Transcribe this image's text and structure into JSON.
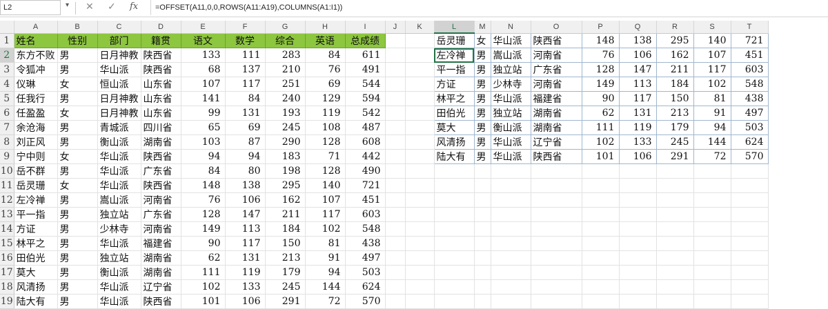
{
  "formula_bar": {
    "name_box": "L2",
    "cancel_icon": "✕",
    "confirm_icon": "✓",
    "fx_label": "fx",
    "formula": "=OFFSET(A11,0,0,ROWS(A11:A19),COLUMNS(A1:I1))"
  },
  "columns": [
    "A",
    "B",
    "C",
    "D",
    "E",
    "F",
    "G",
    "H",
    "I",
    "J",
    "K",
    "L",
    "M",
    "N",
    "O",
    "P",
    "Q",
    "R",
    "S",
    "T"
  ],
  "selected": {
    "column": "L",
    "row": 2
  },
  "header_row": [
    "姓名",
    "性别",
    "部门",
    "籍贯",
    "语文",
    "数学",
    "综合",
    "英语",
    "总成绩"
  ],
  "rows": [
    [
      "东方不败",
      "男",
      "日月神教",
      "陕西省",
      "133",
      "111",
      "283",
      "84",
      "611"
    ],
    [
      "令狐冲",
      "男",
      "华山派",
      "陕西省",
      "68",
      "137",
      "210",
      "76",
      "491"
    ],
    [
      "仪琳",
      "女",
      "恒山派",
      "山东省",
      "107",
      "117",
      "251",
      "69",
      "544"
    ],
    [
      "任我行",
      "男",
      "日月神教",
      "山东省",
      "141",
      "84",
      "240",
      "129",
      "594"
    ],
    [
      "任盈盈",
      "女",
      "日月神教",
      "山东省",
      "99",
      "131",
      "193",
      "119",
      "542"
    ],
    [
      "余沧海",
      "男",
      "青城派",
      "四川省",
      "65",
      "69",
      "245",
      "108",
      "487"
    ],
    [
      "刘正风",
      "男",
      "衡山派",
      "湖南省",
      "103",
      "87",
      "290",
      "128",
      "608"
    ],
    [
      "宁中则",
      "女",
      "华山派",
      "陕西省",
      "94",
      "94",
      "183",
      "71",
      "442"
    ],
    [
      "岳不群",
      "男",
      "华山派",
      "广东省",
      "84",
      "80",
      "198",
      "128",
      "490"
    ],
    [
      "岳灵珊",
      "女",
      "华山派",
      "陕西省",
      "148",
      "138",
      "295",
      "140",
      "721"
    ],
    [
      "左冷禅",
      "男",
      "嵩山派",
      "河南省",
      "76",
      "106",
      "162",
      "107",
      "451"
    ],
    [
      "平一指",
      "男",
      "独立站",
      "广东省",
      "128",
      "147",
      "211",
      "117",
      "603"
    ],
    [
      "方证",
      "男",
      "少林寺",
      "河南省",
      "149",
      "113",
      "184",
      "102",
      "548"
    ],
    [
      "林平之",
      "男",
      "华山派",
      "福建省",
      "90",
      "117",
      "150",
      "81",
      "438"
    ],
    [
      "田伯光",
      "男",
      "独立站",
      "湖南省",
      "62",
      "131",
      "213",
      "91",
      "497"
    ],
    [
      "莫大",
      "男",
      "衡山派",
      "湖南省",
      "111",
      "119",
      "179",
      "94",
      "503"
    ],
    [
      "风清扬",
      "男",
      "华山派",
      "辽宁省",
      "102",
      "133",
      "245",
      "144",
      "624"
    ],
    [
      "陆大有",
      "男",
      "华山派",
      "陕西省",
      "101",
      "106",
      "291",
      "72",
      "570"
    ]
  ],
  "result_rows": [
    [
      "岳灵珊",
      "女",
      "华山派",
      "陕西省",
      "148",
      "138",
      "295",
      "140",
      "721"
    ],
    [
      "左冷禅",
      "男",
      "嵩山派",
      "河南省",
      "76",
      "106",
      "162",
      "107",
      "451"
    ],
    [
      "平一指",
      "男",
      "独立站",
      "广东省",
      "128",
      "147",
      "211",
      "117",
      "603"
    ],
    [
      "方证",
      "男",
      "少林寺",
      "河南省",
      "149",
      "113",
      "184",
      "102",
      "548"
    ],
    [
      "林平之",
      "男",
      "华山派",
      "福建省",
      "90",
      "117",
      "150",
      "81",
      "438"
    ],
    [
      "田伯光",
      "男",
      "独立站",
      "湖南省",
      "62",
      "131",
      "213",
      "91",
      "497"
    ],
    [
      "莫大",
      "男",
      "衡山派",
      "湖南省",
      "111",
      "119",
      "179",
      "94",
      "503"
    ],
    [
      "风清扬",
      "男",
      "华山派",
      "辽宁省",
      "102",
      "133",
      "245",
      "144",
      "624"
    ],
    [
      "陆大有",
      "男",
      "华山派",
      "陕西省",
      "101",
      "106",
      "291",
      "72",
      "570"
    ]
  ],
  "colors": {
    "header_fill": "#8dc63f",
    "selection": "#217346"
  }
}
